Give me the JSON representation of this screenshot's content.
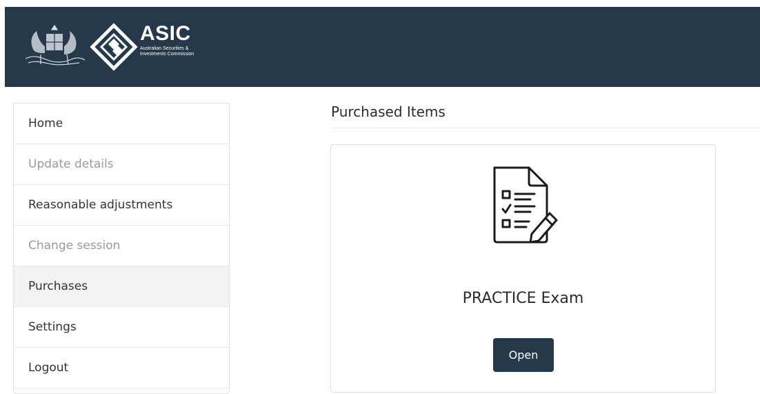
{
  "header": {
    "brand_title": "ASIC",
    "brand_subtitle_line1": "Australian Securities &",
    "brand_subtitle_line2": "Investments Commission",
    "crest_icon": "coat-of-arms-icon",
    "logo_icon": "asic-diamond-logo-icon",
    "background_color": "#26394a"
  },
  "sidebar": {
    "items": [
      {
        "label": "Home",
        "state": "normal"
      },
      {
        "label": "Update details",
        "state": "disabled"
      },
      {
        "label": "Reasonable adjustments",
        "state": "normal"
      },
      {
        "label": "Change session",
        "state": "disabled"
      },
      {
        "label": "Purchases",
        "state": "active"
      },
      {
        "label": "Settings",
        "state": "normal"
      },
      {
        "label": "Logout",
        "state": "normal"
      }
    ]
  },
  "main": {
    "title": "Purchased Items",
    "card": {
      "icon": "exam-checklist-icon",
      "title": "PRACTICE Exam",
      "button_label": "Open",
      "button_color": "#26394a"
    }
  }
}
